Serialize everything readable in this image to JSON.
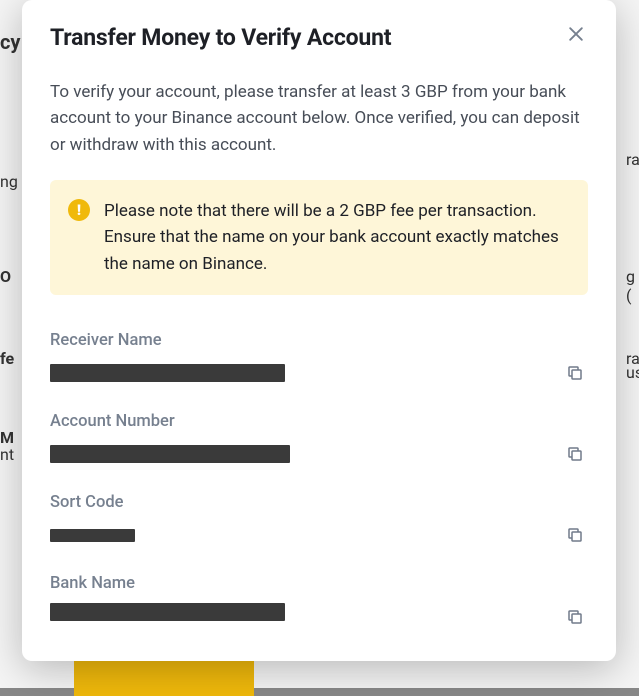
{
  "bg": {
    "t1": "cy",
    "t2": "ng",
    "t3": "raw",
    "t4": "O",
    "t5": "g (",
    "t6": "fe",
    "t7": "raw",
    "t8": "M",
    "t9": "use",
    "bt": "nt"
  },
  "modal": {
    "title": "Transfer Money to Verify Account",
    "instructions": "To verify your account, please transfer at least 3 GBP from your bank account to your Binance account below. Once verified, you can deposit or withdraw with this account.",
    "notice": "Please note that there will be a 2 GBP fee per transaction. Ensure that the name on your bank account exactly matches the name on Binance.",
    "fields": {
      "receiver_name": {
        "label": "Receiver Name"
      },
      "account_number": {
        "label": "Account Number"
      },
      "sort_code": {
        "label": "Sort Code"
      },
      "bank_name": {
        "label": "Bank Name"
      }
    }
  }
}
